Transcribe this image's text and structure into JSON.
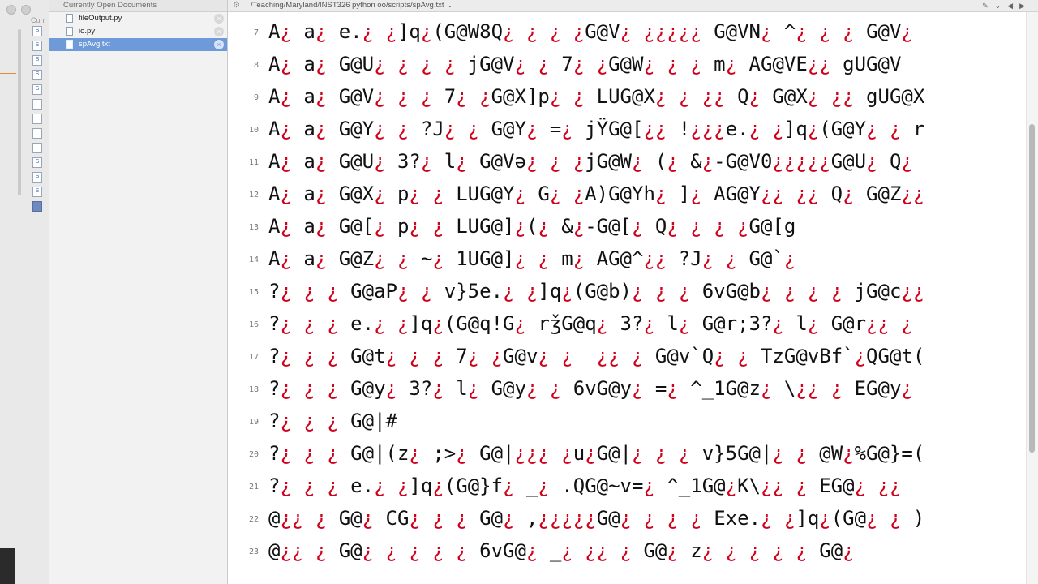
{
  "sidebar": {
    "header": "Currently Open Documents",
    "partial_label": "Curr",
    "documents": [
      {
        "name": "fileOutput.py",
        "selected": false
      },
      {
        "name": "io.py",
        "selected": false
      },
      {
        "name": "spAvg.txt",
        "selected": true
      }
    ]
  },
  "editor": {
    "path": "/Teaching/Maryland/INST326 python oo/scripts/spAvg.txt",
    "line_numbers": [
      "7",
      "8",
      "9",
      "10",
      "11",
      "12",
      "13",
      "14",
      "15",
      "16",
      "17",
      "18",
      "19",
      "20",
      "21",
      "22",
      "23"
    ],
    "lines": [
      "A¿ a¿ e.¿ ¿]q¿(G@W8Q¿ ¿ ¿ ¿G@V¿ ¿¿¿¿¿ G@VN¿ ^¿ ¿ ¿ G@V¿",
      "A¿ a¿ G@U¿ ¿ ¿ ¿ jG@V¿ ¿ 7¿ ¿G@W¿ ¿ ¿ m¿ AG@VE¿¿ gUG@V",
      "A¿ a¿ G@V¿ ¿ ¿ 7¿ ¿G@X]p¿ ¿ LUG@X¿ ¿ ¿¿ Q¿ G@X¿ ¿¿ gUG@X",
      "A¿ a¿ G@Y¿ ¿ ?J¿ ¿ G@Y¿ =¿ jŸG@[¿¿ !¿¿¿e.¿ ¿]q¿(G@Y¿ ¿ r",
      "A¿ a¿ G@U¿ 3?¿ l¿ G@Və¿ ¿ ¿jG@W¿ (¿ &¿-G@V0¿¿¿¿¿G@U¿ Q¿",
      "A¿ a¿ G@X¿ p¿ ¿ LUG@Y¿ G¿ ¿A)G@Yh¿ ]¿ AG@Y¿¿ ¿¿ Q¿ G@Z¿¿",
      "A¿ a¿ G@[¿ p¿ ¿ LUG@]¿(¿ &¿-G@[¿ Q¿ ¿ ¿ ¿G@[g",
      "A¿ a¿ G@Z¿ ¿ ~¿ 1UG@]¿ ¿ m¿ AG@^¿¿ ?J¿ ¿ G@`¿",
      "?¿ ¿ ¿ G@aP¿ ¿ v}5e.¿ ¿]q¿(G@b)¿ ¿ ¿ 6vG@b¿ ¿ ¿ ¿ jG@c¿¿",
      "?¿ ¿ ¿ e.¿ ¿]q¿(G@q!G¿ rǯG@q¿ 3?¿ l¿ G@r;3?¿ l¿ G@r¿¿ ¿",
      "?¿ ¿ ¿ G@t¿ ¿ ¿ 7¿ ¿G@v¿ ¿  ¿¿ ¿ G@v`Q¿ ¿ TzG@vBf`¿QG@t(",
      "?¿ ¿ ¿ G@y¿ 3?¿ l¿ G@y¿ ¿ 6vG@y¿ =¿ ^_1G@z¿ \\¿¿ ¿ EG@y¿",
      "?¿ ¿ ¿ G@|#",
      "?¿ ¿ ¿ G@|(z¿ ;>¿ G@|¿¿¿ ¿u¿G@|¿ ¿ ¿ v}5G@|¿ ¿ @W¿%G@}=(",
      "?¿ ¿ ¿ e.¿ ¿]q¿(G@}f¿ _¿ .QG@~v=¿ ^_1G@¿K\\¿¿ ¿ EG@¿ ¿¿",
      "@¿¿ ¿ G@¿ CG¿ ¿ ¿ G@¿ ,¿¿¿¿¿G@¿ ¿ ¿ ¿ Exe.¿ ¿]q¿(G@¿ ¿ )",
      "@¿¿ ¿ G@¿ ¿ ¿ ¿ ¿ 6vG@¿ _¿ ¿¿ ¿ G@¿ z¿ ¿ ¿ ¿ ¿ G@¿"
    ]
  },
  "colors": {
    "inverted_question_mark": "#d0021b",
    "selection": "#6f9ad9",
    "text": "#111111"
  },
  "icons": [
    "gear-icon",
    "file-icon",
    "close-icon",
    "chevron-down-icon"
  ]
}
